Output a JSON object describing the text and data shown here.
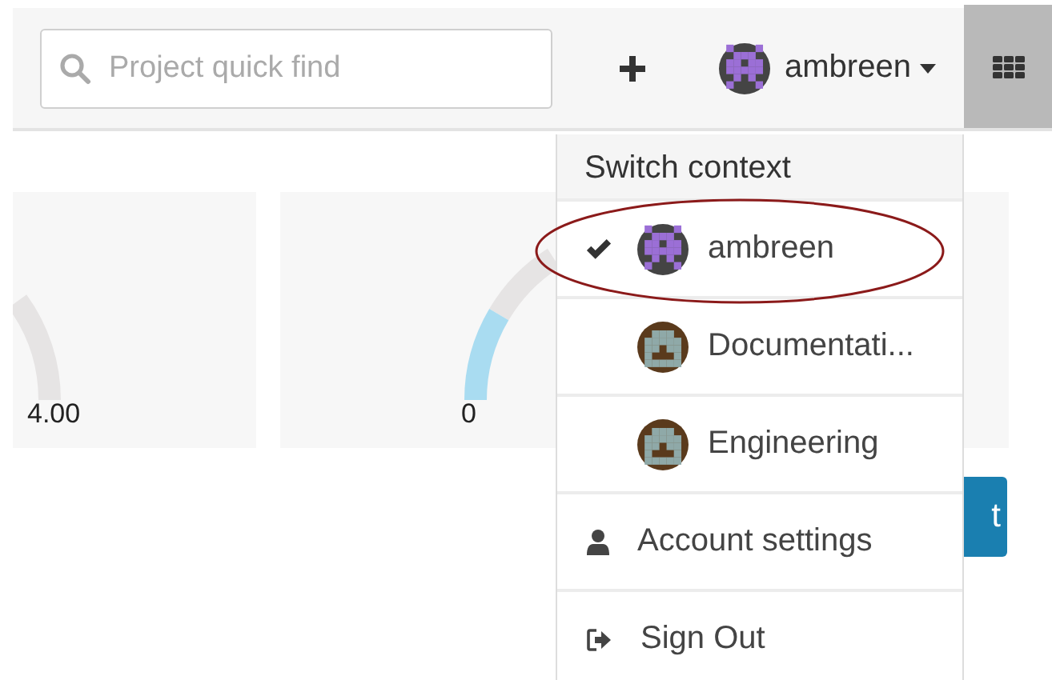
{
  "header": {
    "search": {
      "placeholder": "Project quick find"
    },
    "user": {
      "name": "ambreen",
      "kind": "user"
    }
  },
  "cards": [
    {
      "value": "4.00"
    },
    {
      "value": "0"
    }
  ],
  "button": {
    "label": "t"
  },
  "menu": {
    "title": "Switch context",
    "contexts": [
      {
        "name": "ambreen",
        "kind": "user",
        "selected": true
      },
      {
        "name": "Documentati...",
        "kind": "group",
        "selected": false
      },
      {
        "name": "Engineering",
        "kind": "group",
        "selected": false
      }
    ],
    "actions": [
      {
        "kind": "account",
        "label": "Account settings"
      },
      {
        "kind": "signout",
        "label": "Sign Out"
      }
    ]
  }
}
